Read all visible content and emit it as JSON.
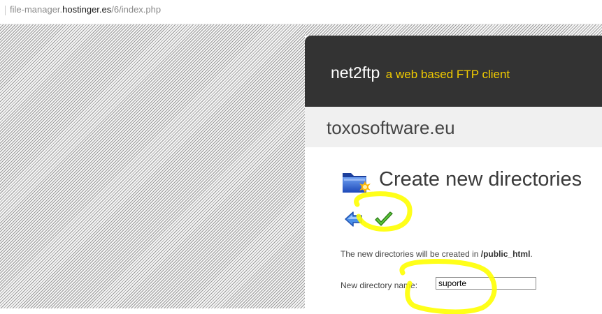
{
  "browser": {
    "url_prefix": "file-manager.",
    "url_domain": "hostinger.es",
    "url_path": "/6/index.php"
  },
  "app": {
    "name": "net2ftp",
    "tagline": "a web based FTP client"
  },
  "host": {
    "name": "toxosoftware.eu"
  },
  "page": {
    "title": "Create new directories",
    "info_prefix": "The new directories will be created in ",
    "info_path": "/public_html",
    "info_suffix": "."
  },
  "form": {
    "directory_label": "New directory name:",
    "directory_value": "suporte"
  },
  "icons": {
    "folder": "new-folder-icon",
    "back": "back-arrow-icon",
    "submit": "check-icon"
  },
  "colors": {
    "header_bg": "#333333",
    "tagline": "#f2cc00",
    "highlight": "#ffff00"
  }
}
